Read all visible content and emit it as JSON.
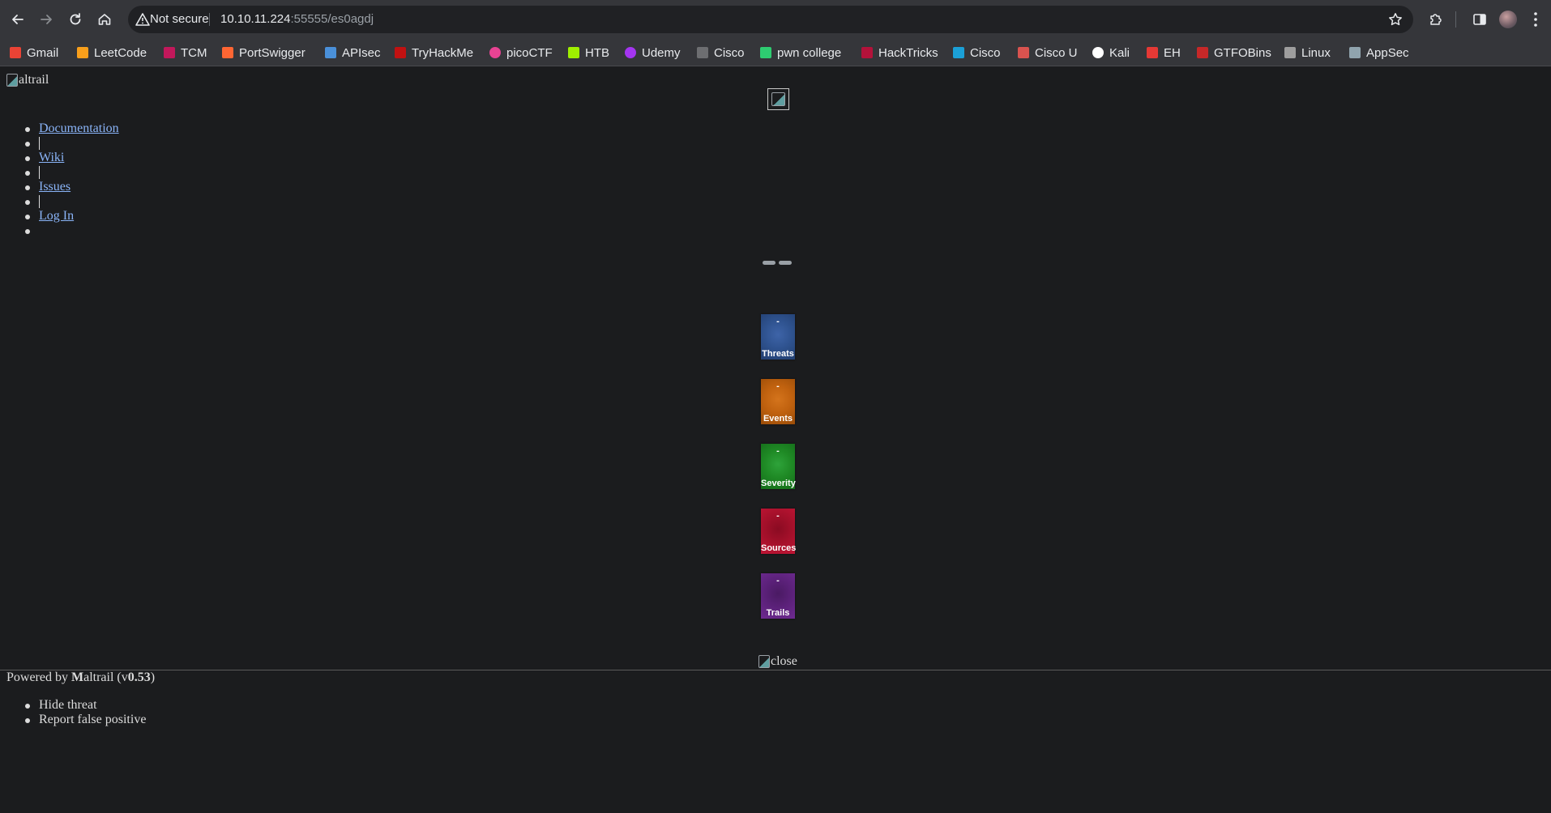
{
  "browser": {
    "security_label": "Not secure",
    "url_host": "10.10.11.224",
    "url_path": ":55555/es0agdj",
    "icons": {
      "back": "arrow-left-icon",
      "forward": "arrow-right-icon",
      "reload": "reload-icon",
      "home": "home-icon",
      "warning": "warning-triangle-icon",
      "star": "star-icon",
      "extensions": "puzzle-icon",
      "sidepanel": "side-panel-icon",
      "menu": "more-vertical-icon"
    }
  },
  "bookmarks": [
    {
      "label": "Gmail",
      "color": "#ea4335"
    },
    {
      "label": "LeetCode",
      "color": "#f89f1b"
    },
    {
      "label": "TCM",
      "color": "#c2185b"
    },
    {
      "label": "PortSwigger",
      "color": "#ff6633"
    },
    {
      "label": "APIsec",
      "color": "#4a90d9"
    },
    {
      "label": "TryHackMe",
      "color": "#c11111"
    },
    {
      "label": "picoCTF",
      "color": "#e84393"
    },
    {
      "label": "HTB",
      "color": "#9fef00"
    },
    {
      "label": "Udemy",
      "color": "#a435f0"
    },
    {
      "label": "Cisco",
      "color": "#6d6e71"
    },
    {
      "label": "pwn college",
      "color": "#2ecc71"
    },
    {
      "label": "HackTricks",
      "color": "#b3123a"
    },
    {
      "label": "Cisco",
      "color": "#1ba0d7"
    },
    {
      "label": "Cisco U",
      "color": "#d9534f"
    },
    {
      "label": "Kali",
      "color": "#ffffff"
    },
    {
      "label": "EH",
      "color": "#e53935"
    },
    {
      "label": "GTFOBins",
      "color": "#c62828"
    },
    {
      "label": "Linux",
      "color": "#9e9e9e"
    },
    {
      "label": "AppSec",
      "color": "#90a4ae"
    }
  ],
  "page": {
    "logo_alt": "altrail",
    "nav": [
      {
        "label": "Documentation"
      },
      {
        "label": "Wiki"
      },
      {
        "label": "Issues"
      },
      {
        "label": "Log In"
      }
    ],
    "tiles": [
      {
        "value": "-",
        "label": "Threats",
        "color": "#2f5390"
      },
      {
        "value": "-",
        "label": "Events",
        "color": "#c1620f"
      },
      {
        "value": "-",
        "label": "Severity",
        "color": "#1f8a25"
      },
      {
        "value": "-",
        "label": "Sources",
        "color": "#a3102a"
      },
      {
        "value": "-",
        "label": "Trails",
        "color": "#5b2179"
      }
    ],
    "close_alt": "close",
    "footer": {
      "prefix": "Powered by ",
      "brand_m": "M",
      "brand_rest": "altrail",
      "version_open": " (v",
      "version": "0.53",
      "version_close": ")"
    },
    "context_menu": [
      "Hide threat",
      "Report false positive"
    ]
  }
}
